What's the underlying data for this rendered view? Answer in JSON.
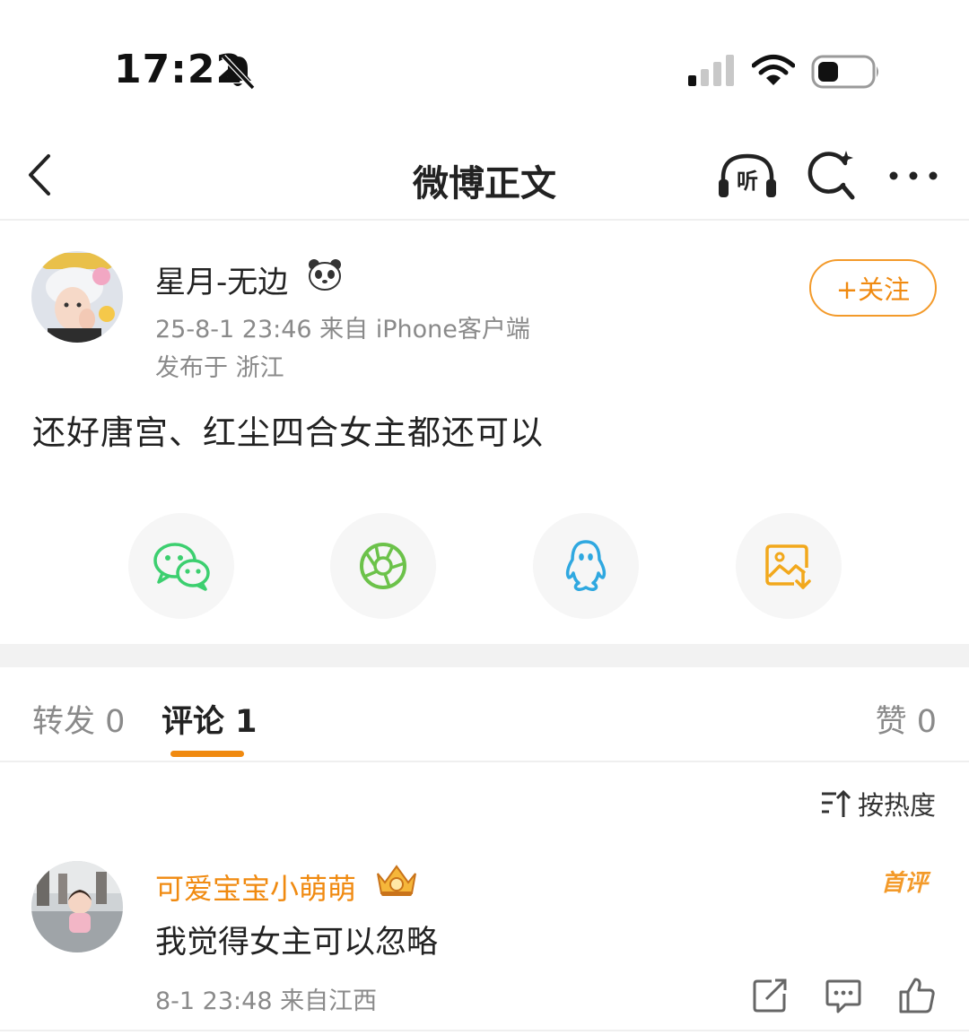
{
  "status_bar": {
    "time": "17:22",
    "icons": [
      "bell-muted-icon",
      "cellular-signal-icon",
      "wifi-icon",
      "battery-icon"
    ]
  },
  "nav": {
    "title": "微博正文",
    "listen_label": "听",
    "icons": [
      "back-arrow-icon",
      "headphones-listen-icon",
      "search-sparkle-icon",
      "more-dots-icon"
    ]
  },
  "post": {
    "author": "星月-无边",
    "author_badge_icon": "panda-icon",
    "meta": "25-8-1 23:46  来自 iPhone客户端",
    "location": "发布于 浙江",
    "follow_label": "+关注",
    "content": "还好唐宫、红尘四合女主都还可以"
  },
  "share": {
    "items": [
      "wechat-icon",
      "moments-icon",
      "qq-icon",
      "save-image-icon"
    ]
  },
  "tabs": {
    "repost": "转发 0",
    "comments": "评论 1",
    "likes": "赞 0"
  },
  "sort": {
    "label": "按热度"
  },
  "comment": {
    "author": "可爱宝宝小萌萌",
    "badge": "首评",
    "text": "我觉得女主可以忽略",
    "meta": "8-1 23:48  来自江西"
  },
  "colors": {
    "accent": "#f08a10",
    "muted_text": "#8a8a8a",
    "wechat": "#3ccf6f",
    "moments": "#6cc24a",
    "qq": "#2fa8e0",
    "save": "#f2a81c"
  }
}
